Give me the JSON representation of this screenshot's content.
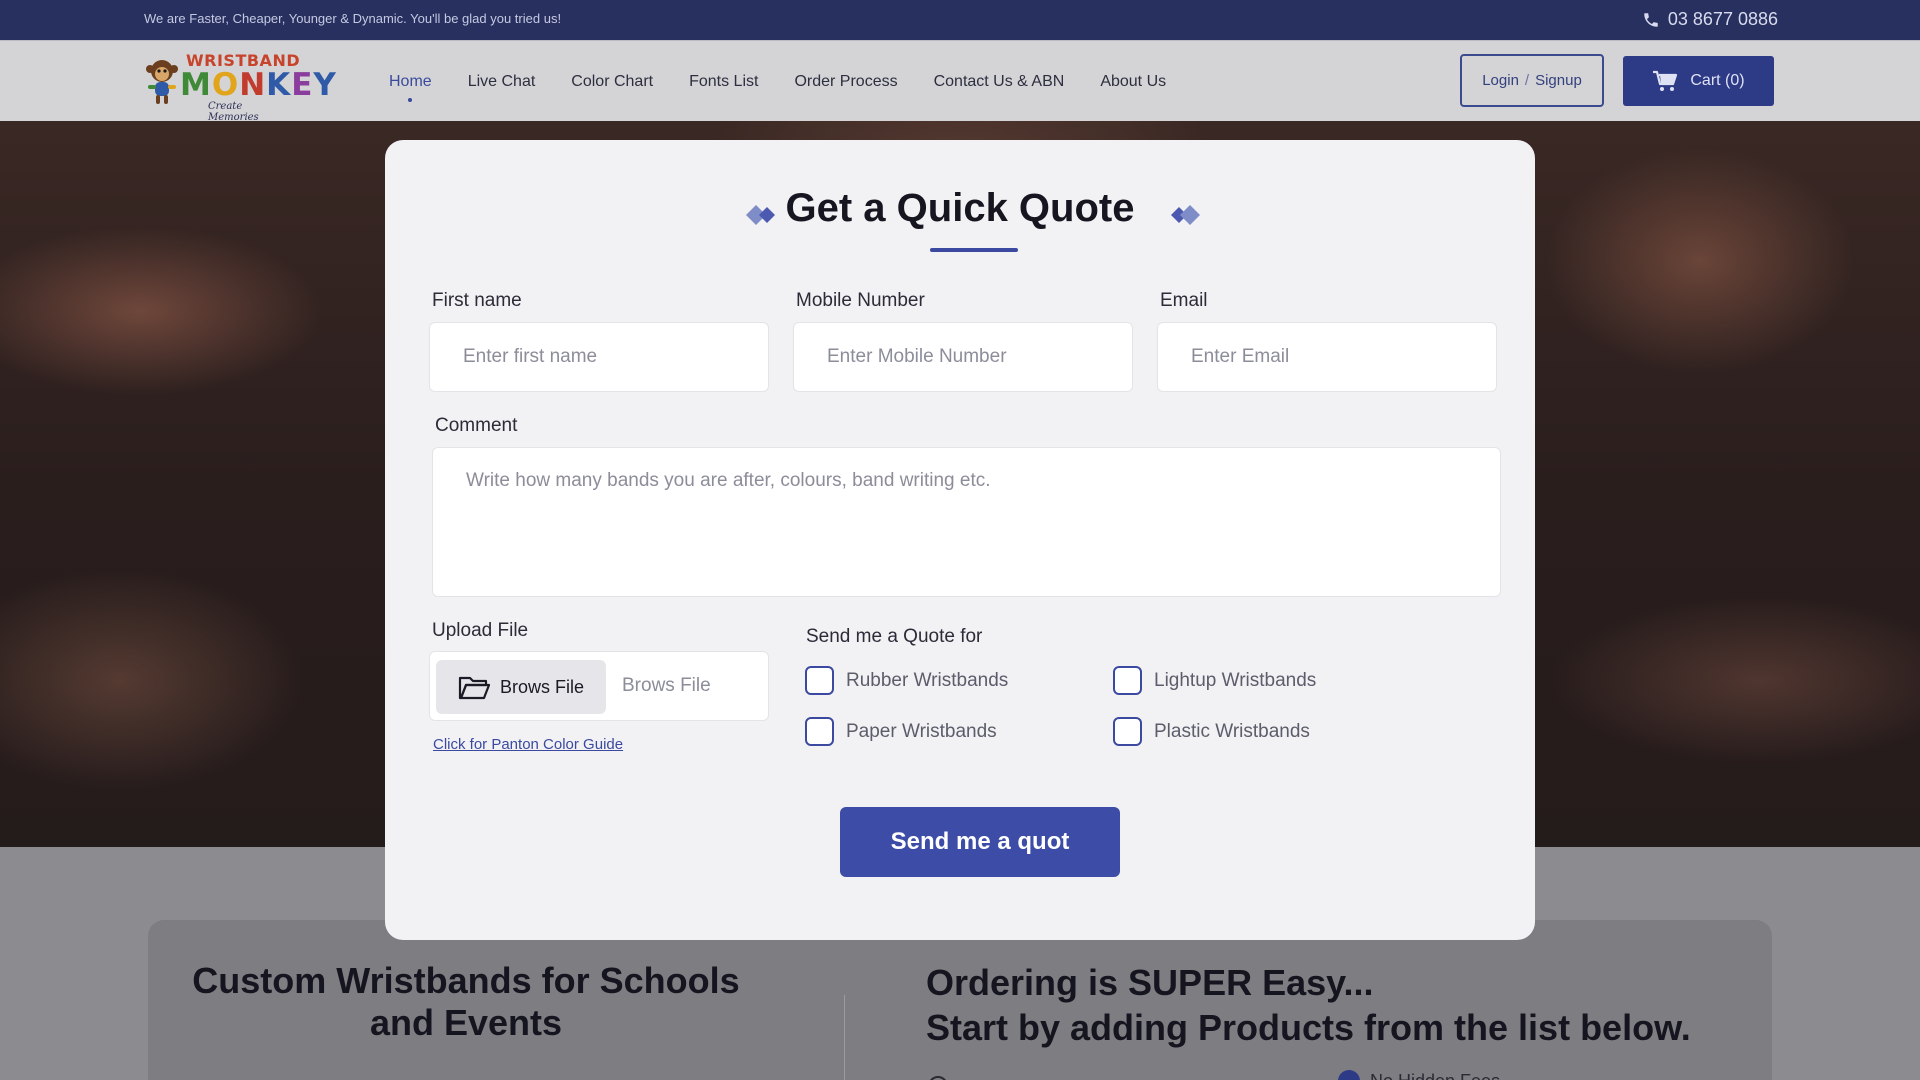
{
  "topbar": {
    "tagline": "We are Faster, Cheaper, Younger & Dynamic. You'll be glad you tried us!",
    "phone": "03 8677 0886",
    "phone_icon": "phone-icon"
  },
  "logo": {
    "line1": "WRISTBAND",
    "line2": [
      "M",
      "O",
      "N",
      "K",
      "E",
      "Y"
    ],
    "tagline": "Create Memories"
  },
  "nav": {
    "items": [
      {
        "label": "Home",
        "active": true
      },
      {
        "label": "Live Chat"
      },
      {
        "label": "Color Chart"
      },
      {
        "label": "Fonts List"
      },
      {
        "label": "Order Process"
      },
      {
        "label": "Contact Us & ABN"
      },
      {
        "label": "About Us"
      }
    ]
  },
  "account": {
    "login_label": "Login",
    "separator": "/",
    "signup_label": "Signup",
    "cart_label": "Cart (0)",
    "cart_icon": "cart-icon"
  },
  "quote_form": {
    "title": "Get a Quick Quote",
    "first_name": {
      "label": "First name",
      "placeholder": "Enter first name"
    },
    "mobile": {
      "label": "Mobile Number",
      "placeholder": "Enter Mobile Number"
    },
    "email": {
      "label": "Email",
      "placeholder": "Enter Email"
    },
    "comment": {
      "label": "Comment",
      "placeholder": "Write how many bands you are after, colours, band writing etc."
    },
    "upload": {
      "label": "Upload File",
      "button_label": "Brows File",
      "file_text": "Brows File",
      "icon": "folder-icon"
    },
    "panton_link": "Click for Panton Color Guide",
    "quote_for": {
      "label": "Send me a Quote for",
      "options": [
        "Rubber Wristbands",
        "Lightup Wristbands",
        "Paper Wristbands",
        "Plastic Wristbands"
      ]
    },
    "submit_label": "Send me a quot",
    "accent_color": "#3d4ca6"
  },
  "info": {
    "left_heading": "Custom Wristbands for Schools and Events",
    "right_heading_line1": "Ordering is SUPER Easy...",
    "right_heading_line2": "Start by adding Products from the list below.",
    "feature_partial": "No Hidden Fees"
  }
}
